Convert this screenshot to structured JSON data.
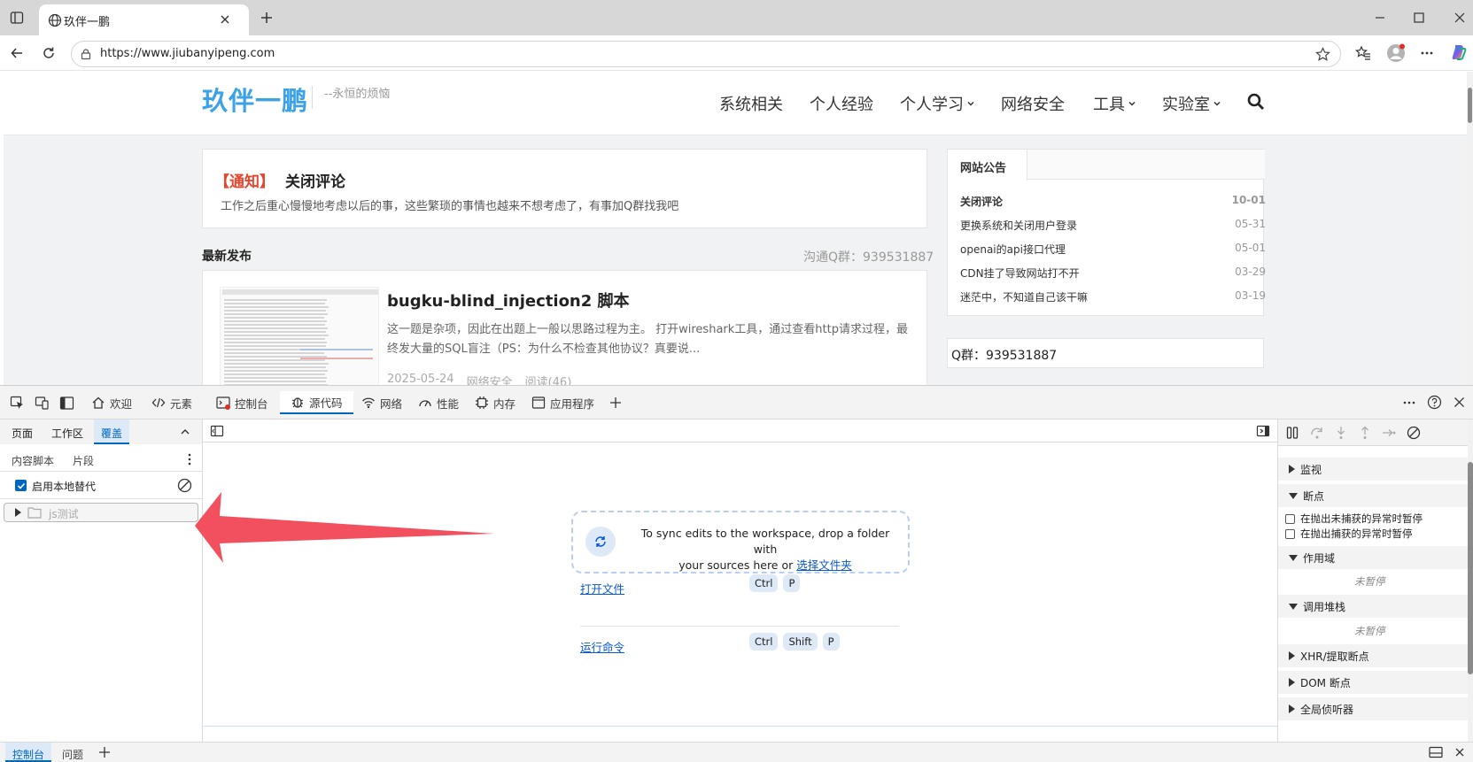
{
  "browser": {
    "tab_title": "玖伴一鹏",
    "url": "https://www.jiubanyipeng.com"
  },
  "site": {
    "logo": "玖伴一鹏",
    "tagline": "--永恒的烦恼",
    "nav": [
      "系统相关",
      "个人经验",
      "个人学习",
      "网络安全",
      "工具",
      "实验室"
    ],
    "notice": {
      "tag": "【通知】",
      "title": "关闭评论",
      "text": "工作之后重心慢慢地考虑以后的事，这些繁琐的事情也越来不想考虑了，有事加Q群找我吧"
    },
    "latest_label": "最新发布",
    "qq_group_label": "沟通Q群：939531887",
    "post": {
      "title": "bugku-blind_injection2 脚本",
      "excerpt": "这一题是杂项，因此在出题上一般以思路过程为主。 打开wireshark工具，通过查看http请求过程，最终发大量的SQL盲注（PS：为什么不检查其他协议？真要说...",
      "date": "2025-05-24",
      "category": "网络安全",
      "reads": "阅读(46)"
    },
    "announce": {
      "title": "网站公告",
      "items": [
        {
          "title": "关闭评论",
          "date": "10-01"
        },
        {
          "title": "更换系统和关闭用户登录",
          "date": "05-31"
        },
        {
          "title": "openai的api接口代理",
          "date": "05-01"
        },
        {
          "title": "CDN挂了导致网站打不开",
          "date": "03-29"
        },
        {
          "title": "迷茫中，不知道自己该干嘛",
          "date": "03-19"
        }
      ]
    },
    "qq_box": "Q群：939531887"
  },
  "devtools": {
    "tabs": [
      "欢迎",
      "元素",
      "控制台",
      "源代码",
      "网络",
      "性能",
      "内存",
      "应用程序"
    ],
    "active_tab": "源代码",
    "left": {
      "subtabs": [
        "页面",
        "工作区",
        "覆盖"
      ],
      "active_subtab": "覆盖",
      "subtabs2": [
        "内容脚本",
        "片段"
      ],
      "enable_override_label": "启用本地替代",
      "enable_override_checked": true,
      "folder": "js测试"
    },
    "center": {
      "sync_text_1": "To sync edits to the workspace, drop a folder with",
      "sync_text_2": "your sources here or ",
      "sync_link": "选择文件夹",
      "shortcuts": [
        {
          "label": "打开文件",
          "keys": [
            "Ctrl",
            "P"
          ]
        },
        {
          "label": "运行命令",
          "keys": [
            "Ctrl",
            "Shift",
            "P"
          ]
        }
      ]
    },
    "right": {
      "watch": "监视",
      "breakpoints": "断点",
      "pause_uncaught": "在抛出未捕获的异常时暂停",
      "pause_caught": "在抛出捕获的异常时暂停",
      "scope": "作用域",
      "not_paused": "未暂停",
      "callstack": "调用堆栈",
      "not_paused_2": "未暂停",
      "xhr": "XHR/提取断点",
      "dom": "DOM 断点",
      "listeners": "全局侦听器"
    },
    "bottom": {
      "tabs": [
        "控制台",
        "问题"
      ]
    }
  },
  "colors": {
    "logo": "#3ba2e8",
    "notice_tag": "#e8452c",
    "arrow": "#f2505f",
    "devtools_accent": "#0067c0"
  }
}
